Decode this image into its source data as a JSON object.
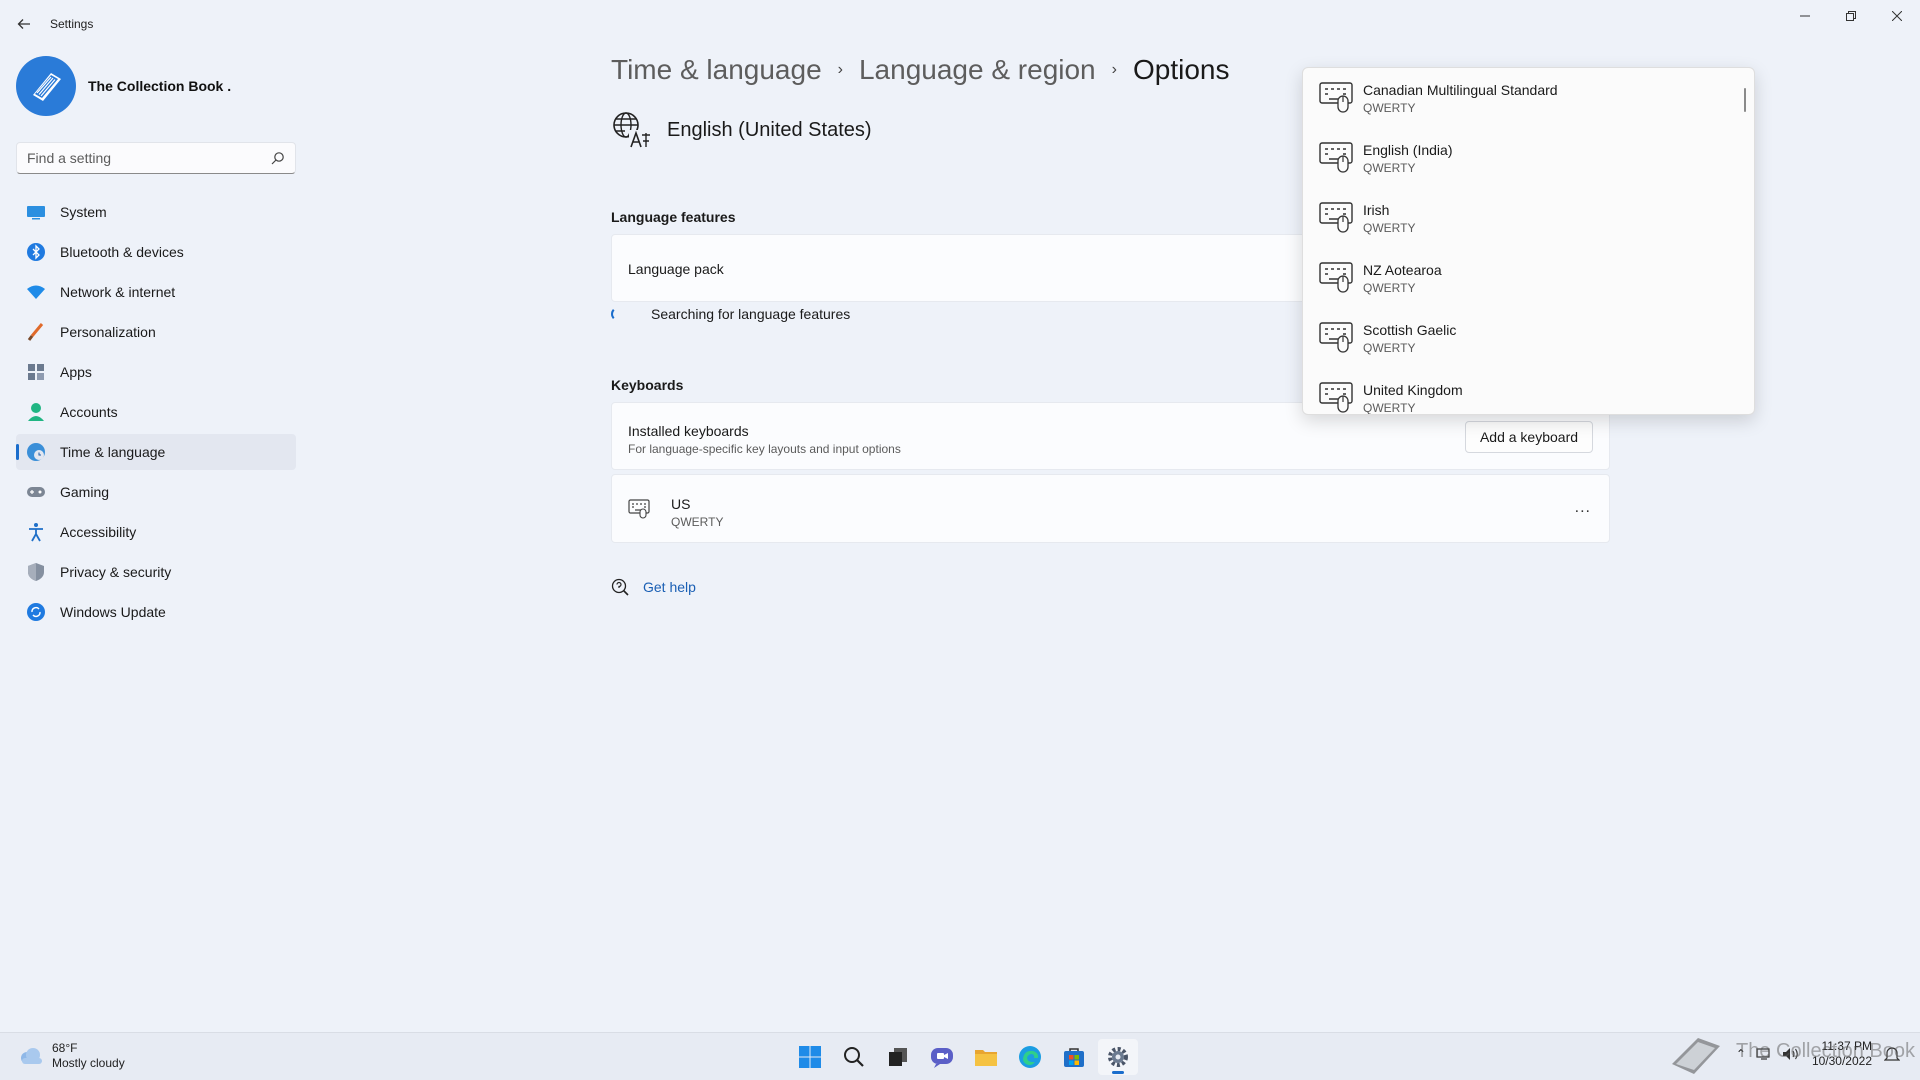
{
  "window": {
    "title": "Settings"
  },
  "profile": {
    "name": "The Collection Book ."
  },
  "search": {
    "placeholder": "Find a setting"
  },
  "sidebar": {
    "items": [
      {
        "label": "System",
        "icon": "monitor-icon"
      },
      {
        "label": "Bluetooth & devices",
        "icon": "bluetooth-icon"
      },
      {
        "label": "Network & internet",
        "icon": "wifi-icon"
      },
      {
        "label": "Personalization",
        "icon": "brush-icon"
      },
      {
        "label": "Apps",
        "icon": "apps-icon"
      },
      {
        "label": "Accounts",
        "icon": "person-icon"
      },
      {
        "label": "Time & language",
        "icon": "globe-clock-icon",
        "selected": true
      },
      {
        "label": "Gaming",
        "icon": "gamepad-icon"
      },
      {
        "label": "Accessibility",
        "icon": "accessibility-icon"
      },
      {
        "label": "Privacy & security",
        "icon": "shield-icon"
      },
      {
        "label": "Windows Update",
        "icon": "update-icon"
      }
    ]
  },
  "breadcrumb": {
    "items": [
      "Time & language",
      "Language & region",
      "Options"
    ]
  },
  "language": {
    "title": "English (United States)",
    "icon": "language-icon"
  },
  "language_features": {
    "label": "Language features",
    "language_pack": "Language pack",
    "status": "Searching for language features"
  },
  "keyboards": {
    "label": "Keyboards",
    "installed_title": "Installed keyboards",
    "installed_desc": "For language-specific key layouts and input options",
    "add_button": "Add a keyboard",
    "installed": [
      {
        "name": "US",
        "layout": "QWERTY"
      }
    ],
    "more_label": "..."
  },
  "help": {
    "label": "Get help"
  },
  "flyout": {
    "items": [
      {
        "name": "Canadian Multilingual Standard",
        "layout": "QWERTY"
      },
      {
        "name": "English (India)",
        "layout": "QWERTY"
      },
      {
        "name": "Irish",
        "layout": "QWERTY"
      },
      {
        "name": "NZ Aotearoa",
        "layout": "QWERTY"
      },
      {
        "name": "Scottish Gaelic",
        "layout": "QWERTY"
      },
      {
        "name": "United Kingdom",
        "layout": "QWERTY"
      }
    ]
  },
  "taskbar": {
    "weather": {
      "temp": "68°F",
      "desc": "Mostly cloudy"
    },
    "apps": [
      "windows-start-icon",
      "search-icon",
      "task-view-icon",
      "chat-icon",
      "file-explorer-icon",
      "edge-icon",
      "store-icon",
      "settings-icon"
    ],
    "clock": {
      "time": "11:37 PM",
      "date": "10/30/2022"
    }
  },
  "watermark": {
    "text": "The Collection Book"
  },
  "colors": {
    "accent": "#1a6dcc",
    "background": "#eef2f9",
    "card": "#fbfcfe"
  }
}
